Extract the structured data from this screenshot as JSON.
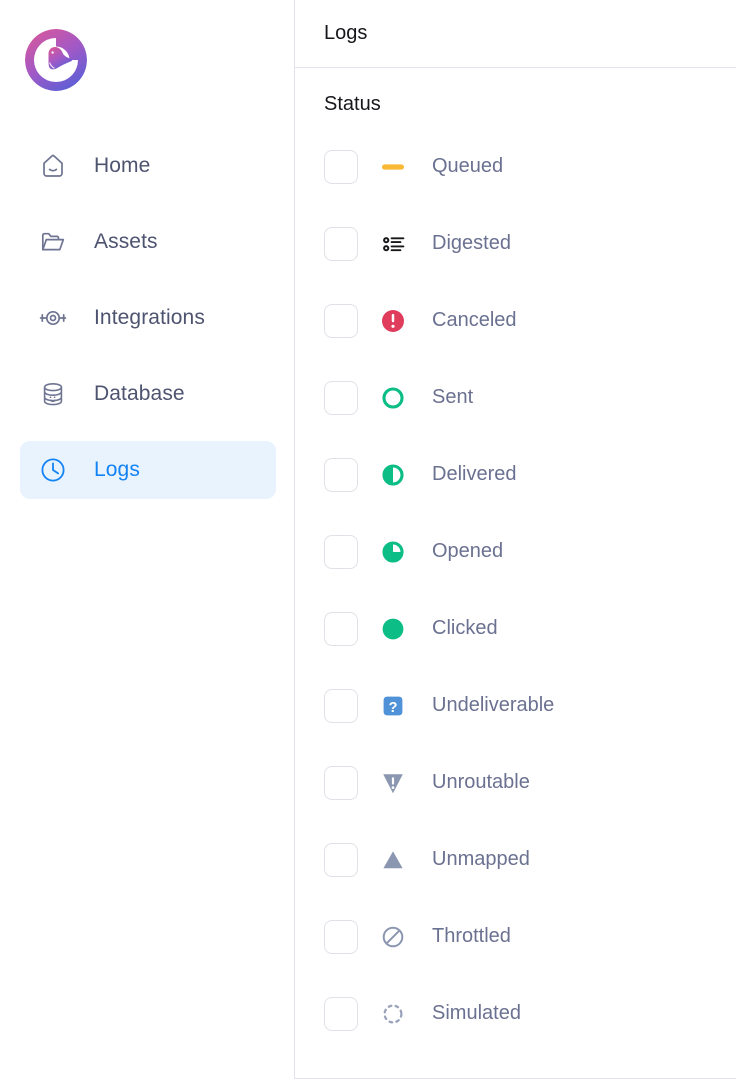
{
  "brand": {
    "logo_icon": "bird-logo-icon",
    "gradient_from": "#d4579e",
    "gradient_mid": "#a259c6",
    "gradient_to": "#5a5fd6"
  },
  "sidebar": {
    "items": [
      {
        "label": "Home",
        "icon": "home-icon",
        "active": false
      },
      {
        "label": "Assets",
        "icon": "folder-icon",
        "active": false
      },
      {
        "label": "Integrations",
        "icon": "integrations-icon",
        "active": false
      },
      {
        "label": "Database",
        "icon": "database-icon",
        "active": false
      },
      {
        "label": "Logs",
        "icon": "clock-icon",
        "active": true
      }
    ],
    "active_color": "#1383f5",
    "active_bg": "#e8f3fe",
    "idle_color": "#4e5470"
  },
  "panel": {
    "title": "Logs",
    "section_label": "Status",
    "statuses": [
      {
        "label": "Queued",
        "icon": "dash-icon",
        "color": "#f9b936",
        "checked": false
      },
      {
        "label": "Digested",
        "icon": "list-digest-icon",
        "color": "#18181b",
        "checked": false
      },
      {
        "label": "Canceled",
        "icon": "error-circle-icon",
        "color": "#e03c5c",
        "checked": false
      },
      {
        "label": "Sent",
        "icon": "circle-outline-icon",
        "color": "#0cbd85",
        "checked": false
      },
      {
        "label": "Delivered",
        "icon": "circle-half-icon",
        "color": "#0cbd85",
        "checked": false
      },
      {
        "label": "Opened",
        "icon": "circle-three-quarter-icon",
        "color": "#0cbd85",
        "checked": false
      },
      {
        "label": "Clicked",
        "icon": "circle-filled-icon",
        "color": "#0cbd85",
        "checked": false
      },
      {
        "label": "Undeliverable",
        "icon": "question-square-icon",
        "color": "#4f92d8",
        "checked": false
      },
      {
        "label": "Unroutable",
        "icon": "warning-triangle-down-icon",
        "color": "#8b96b0",
        "checked": false
      },
      {
        "label": "Unmapped",
        "icon": "triangle-up-icon",
        "color": "#8b96b0",
        "checked": false
      },
      {
        "label": "Throttled",
        "icon": "prohibited-icon",
        "color": "#8b96b0",
        "checked": false
      },
      {
        "label": "Simulated",
        "icon": "dashed-circle-icon",
        "color": "#8b96b0",
        "checked": false
      }
    ]
  }
}
